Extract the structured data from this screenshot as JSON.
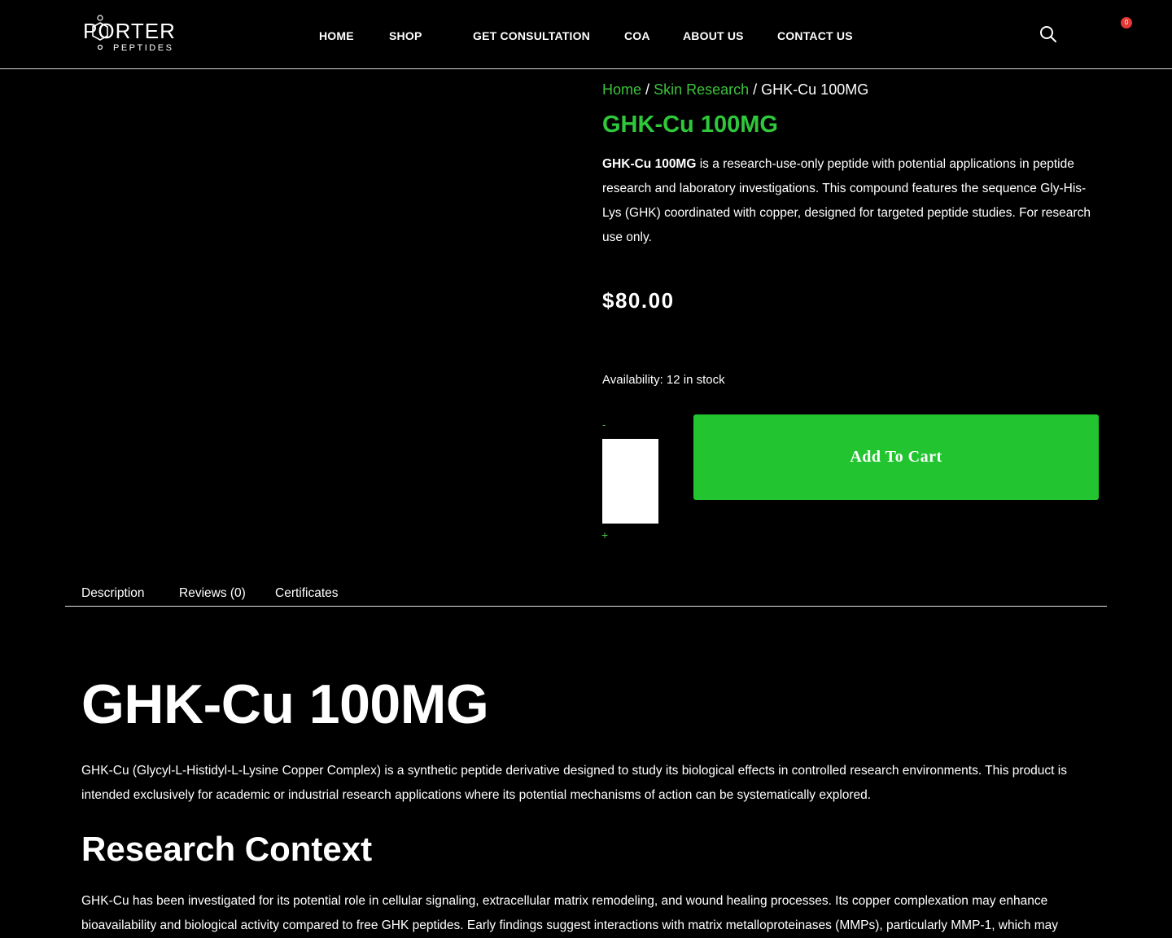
{
  "brand": {
    "name": "PORTER",
    "tagline": "PEPTIDES"
  },
  "nav": {
    "home": "HOME",
    "shop": "SHOP",
    "consultation": "GET CONSULTATION",
    "coa": "COA",
    "about": "ABOUT US",
    "contact": "CONTACT US"
  },
  "cart": {
    "count": "0"
  },
  "breadcrumb": {
    "home": "Home",
    "category": "Skin Research",
    "separator": "/",
    "current": "GHK-Cu 100MG"
  },
  "product": {
    "title": "GHK-Cu 100MG",
    "short_desc_bold": "GHK-Cu 100MG",
    "short_desc_rest": " is a research-use-only peptide with potential applications in peptide research and laboratory investigations. This compound features the sequence Gly-His-Lys (GHK) coordinated with copper, designed for targeted peptide studies. For research use only.",
    "price": "$80.00",
    "availability": "Availability: 12 in stock",
    "qty_minus": "-",
    "qty_plus": "+",
    "qty_value": "",
    "add_to_cart": "Add To Cart"
  },
  "tabs": {
    "description": "Description",
    "reviews": "Reviews (0)",
    "certificates": "Certificates"
  },
  "description": {
    "heading": "GHK-Cu 100MG",
    "intro": "GHK-Cu (Glycyl-L-Histidyl-L-Lysine Copper Complex) is a synthetic peptide derivative designed to study its biological effects in controlled research environments. This product is intended exclusively for academic or industrial research applications where its potential mechanisms of action can be systematically explored.",
    "section_heading": "Research Context",
    "section_text": "GHK-Cu has been investigated for its potential role in cellular signaling, extracellular matrix remodeling, and wound healing processes. Its copper complexation may enhance bioavailability and biological activity compared to free GHK peptides. Early findings suggest interactions with matrix metalloproteinases (MMPs), particularly MMP-1, which may"
  },
  "icons": {
    "search": "search-icon",
    "cart": "cart-badge",
    "logo": "hexagon-logo-icon"
  },
  "colors": {
    "accent_green": "#22c430",
    "link_green": "#3cc23c",
    "title_green": "#2ec83a",
    "badge_red": "#e53935",
    "background": "#000000"
  }
}
